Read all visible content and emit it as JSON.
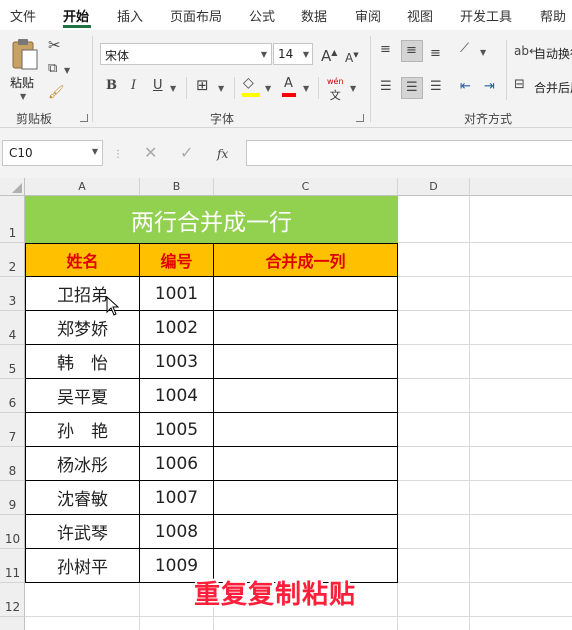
{
  "menu": {
    "items": [
      "文件",
      "开始",
      "插入",
      "页面布局",
      "公式",
      "数据",
      "审阅",
      "视图",
      "开发工具",
      "帮助"
    ],
    "active": "开始"
  },
  "ribbon": {
    "clipboard": {
      "paste_label": "粘贴",
      "group_label": "剪贴板"
    },
    "font": {
      "font_name": "宋体",
      "font_size": "14",
      "group_label": "字体",
      "bold": "B",
      "italic": "I",
      "underline": "U",
      "grow": "A",
      "shrink": "A",
      "phonetic": "wén",
      "color_a": "A"
    },
    "alignment": {
      "wrap_label": "自动换行",
      "merge_label": "合并后居中",
      "group_label": "对齐方式"
    }
  },
  "formula_bar": {
    "name_box": "C10",
    "fx": "fx",
    "value": ""
  },
  "grid": {
    "columns": [
      "A",
      "B",
      "C",
      "D"
    ],
    "rows": [
      "1",
      "2",
      "3",
      "4",
      "5",
      "6",
      "7",
      "8",
      "9",
      "10",
      "11",
      "12"
    ],
    "title": "两行合并成一行",
    "headers": [
      "姓名",
      "编号",
      "合并成一列"
    ],
    "records": [
      {
        "name": "卫招弟",
        "id": "1001"
      },
      {
        "name": "郑梦娇",
        "id": "1002"
      },
      {
        "name": "韩　怡",
        "id": "1003"
      },
      {
        "name": "吴平夏",
        "id": "1004"
      },
      {
        "name": "孙　艳",
        "id": "1005"
      },
      {
        "name": "杨冰彤",
        "id": "1006"
      },
      {
        "name": "沈睿敏",
        "id": "1007"
      },
      {
        "name": "许武琴",
        "id": "1008"
      },
      {
        "name": "孙树平",
        "id": "1009"
      }
    ]
  },
  "caption": "重复复制粘贴",
  "colors": {
    "title_bg": "#92d050",
    "header_bg": "#ffc000",
    "header_text": "#e00000",
    "accent": "#217346",
    "caption": "#ff1f3a"
  }
}
